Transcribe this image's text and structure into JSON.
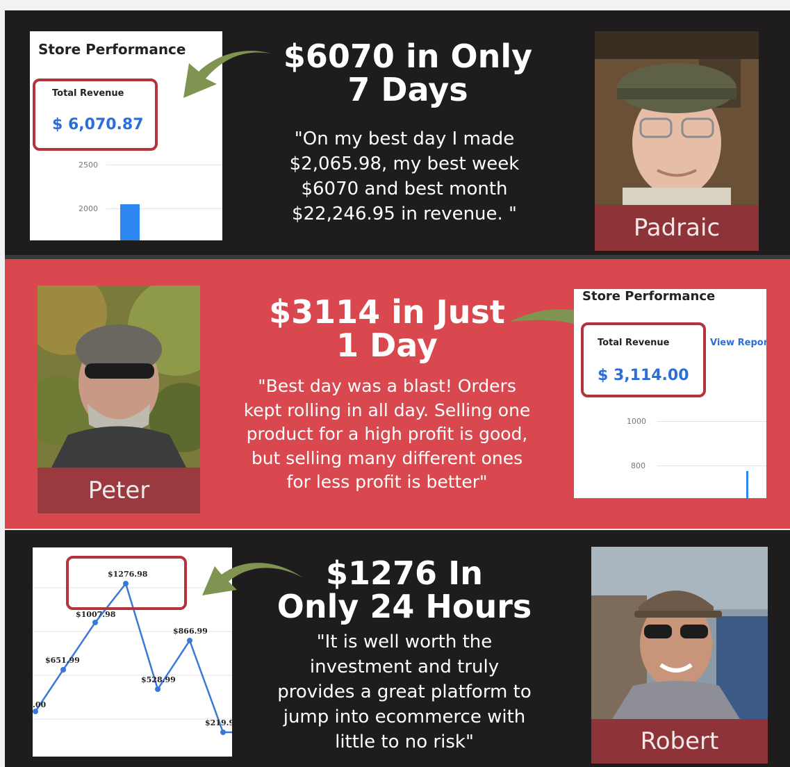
{
  "testimonials": [
    {
      "headline_line1": "$6070 in Only",
      "headline_line2": "7 Days",
      "quote_lines": [
        "\"On my best day I made",
        "$2,065.98, my best week",
        "$6070 and best month",
        "$22,246.95 in revenue. \""
      ],
      "name": "Padraic",
      "screenshot": {
        "title": "Store Performance",
        "total_revenue_label": "Total Revenue",
        "total_revenue_value": "$ 6,070.87",
        "ticks": [
          "2500",
          "2000"
        ]
      }
    },
    {
      "headline_line1": "$3114 in Just",
      "headline_line2": "1 Day",
      "quote_lines": [
        "\"Best day was a blast!  Orders",
        "kept rolling in all day.  Selling one",
        "product for a high profit is good,",
        "but selling many different ones",
        "for less profit is better\""
      ],
      "name": "Peter",
      "screenshot": {
        "title": "Store Performance",
        "total_revenue_label": "Total Revenue",
        "total_revenue_value": "$ 3,114.00",
        "view_report": "View Repor",
        "ticks": [
          "1000",
          "800"
        ]
      }
    },
    {
      "headline_line1": "$1276 In",
      "headline_line2": "Only 24 Hours",
      "quote_lines": [
        "\"It is well worth the",
        "investment and truly",
        "provides a great platform to",
        "jump into ecommerce with",
        "little to no risk\""
      ],
      "name": "Robert",
      "screenshot": {
        "point_labels": [
          ".00",
          "$651.99",
          "$1007.98",
          "$1276.98",
          "$528.99",
          "$866.99",
          "$219.9"
        ]
      }
    }
  ],
  "colors": {
    "dark_panel": "#1e1c1d",
    "red_panel": "#d9484e",
    "nameplate": "#8e3439",
    "arrow": "#7f9450",
    "revenue_blue": "#2b6fd6",
    "highlight_box": "#b3343b"
  }
}
